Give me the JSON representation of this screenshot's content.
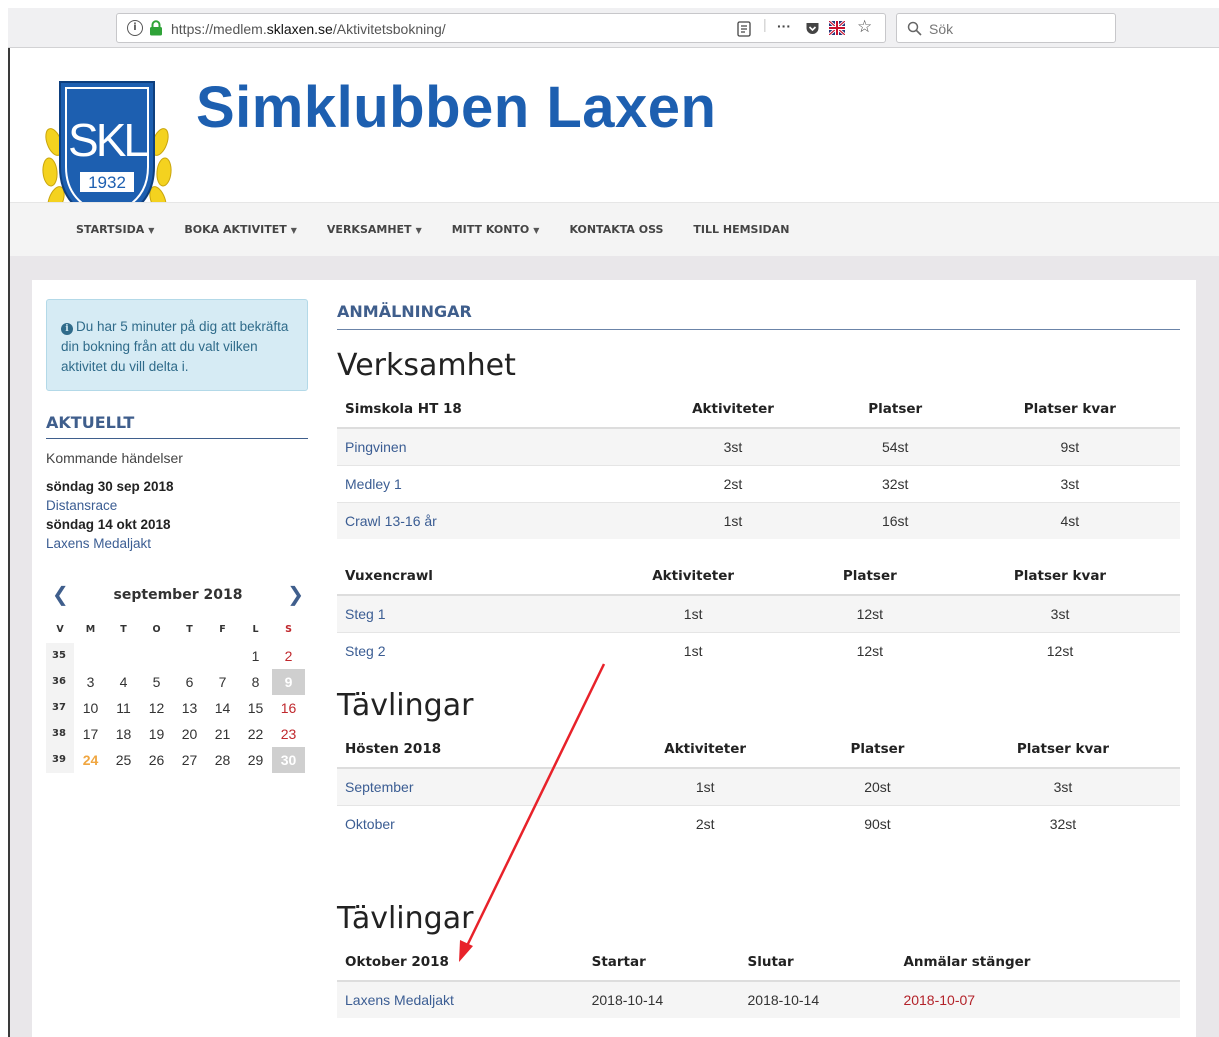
{
  "browser": {
    "url_prefix": "https://medlem.",
    "url_domain": "sklaxen.se",
    "url_path": "/Aktivitetsbokning/",
    "search_placeholder": "Sök",
    "more_label": "···"
  },
  "header": {
    "site_title": "Simklubben Laxen",
    "logo_text": "SKL",
    "logo_year": "1932"
  },
  "nav": [
    {
      "label": "STARTSIDA",
      "dropdown": true
    },
    {
      "label": "BOKA AKTIVITET",
      "dropdown": true
    },
    {
      "label": "VERKSAMHET",
      "dropdown": true
    },
    {
      "label": "MITT KONTO",
      "dropdown": true
    },
    {
      "label": "KONTAKTA OSS",
      "dropdown": false
    },
    {
      "label": "TILL HEMSIDAN",
      "dropdown": false
    }
  ],
  "sidebar": {
    "alert_text": "Du har 5 minuter på dig att bekräfta din bokning från att du valt vilken aktivitet du vill delta i.",
    "aktuellt_heading": "AKTUELLT",
    "events_subheading": "Kommande händelser",
    "events": [
      {
        "date": "söndag 30 sep 2018",
        "name": "Distansrace"
      },
      {
        "date": "söndag 14 okt 2018",
        "name": "Laxens Medaljakt"
      }
    ]
  },
  "calendar": {
    "title": "september 2018",
    "weekdays": [
      "V",
      "M",
      "T",
      "O",
      "T",
      "F",
      "L",
      "S"
    ],
    "weeks": [
      {
        "wk": "35",
        "days": [
          "",
          "",
          "",
          "",
          "",
          "1",
          "2"
        ]
      },
      {
        "wk": "36",
        "days": [
          "3",
          "4",
          "5",
          "6",
          "7",
          "8",
          "9"
        ]
      },
      {
        "wk": "37",
        "days": [
          "10",
          "11",
          "12",
          "13",
          "14",
          "15",
          "16"
        ]
      },
      {
        "wk": "38",
        "days": [
          "17",
          "18",
          "19",
          "20",
          "21",
          "22",
          "23"
        ]
      },
      {
        "wk": "39",
        "days": [
          "24",
          "25",
          "26",
          "27",
          "28",
          "29",
          "30"
        ]
      }
    ],
    "today": "24",
    "highlighted": [
      "9",
      "30"
    ]
  },
  "main": {
    "heading": "ANMÄLNINGAR",
    "verksamhet_heading": "Verksamhet",
    "tavlingar_heading_1": "Tävlingar",
    "tavlingar_heading_2": "Tävlingar",
    "simskola": {
      "headers": [
        "Simskola HT 18",
        "Aktiviteter",
        "Platser",
        "Platser kvar"
      ],
      "rows": [
        [
          "Pingvinen",
          "3st",
          "54st",
          "9st"
        ],
        [
          "Medley 1",
          "2st",
          "32st",
          "3st"
        ],
        [
          "Crawl 13-16 år",
          "1st",
          "16st",
          "4st"
        ]
      ]
    },
    "vuxencrawl": {
      "headers": [
        "Vuxencrawl",
        "Aktiviteter",
        "Platser",
        "Platser kvar"
      ],
      "rows": [
        [
          "Steg 1",
          "1st",
          "12st",
          "3st"
        ],
        [
          "Steg 2",
          "1st",
          "12st",
          "12st"
        ]
      ]
    },
    "hosten": {
      "headers": [
        "Hösten 2018",
        "Aktiviteter",
        "Platser",
        "Platser kvar"
      ],
      "rows": [
        [
          "September",
          "1st",
          "20st",
          "3st"
        ],
        [
          "Oktober",
          "2st",
          "90st",
          "32st"
        ]
      ]
    },
    "oktober": {
      "headers": [
        "Oktober 2018",
        "Startar",
        "Slutar",
        "Anmälar stänger"
      ],
      "rows": [
        [
          "Laxens Medaljakt",
          "2018-10-14",
          "2018-10-14",
          "2018-10-07"
        ]
      ]
    }
  },
  "colors": {
    "brand_blue": "#1d5fb0",
    "heading_blue": "#3f5e8c",
    "link_blue": "#3b5d93",
    "deadline_red": "#b3232a",
    "annotation_arrow": "#e8222a"
  }
}
